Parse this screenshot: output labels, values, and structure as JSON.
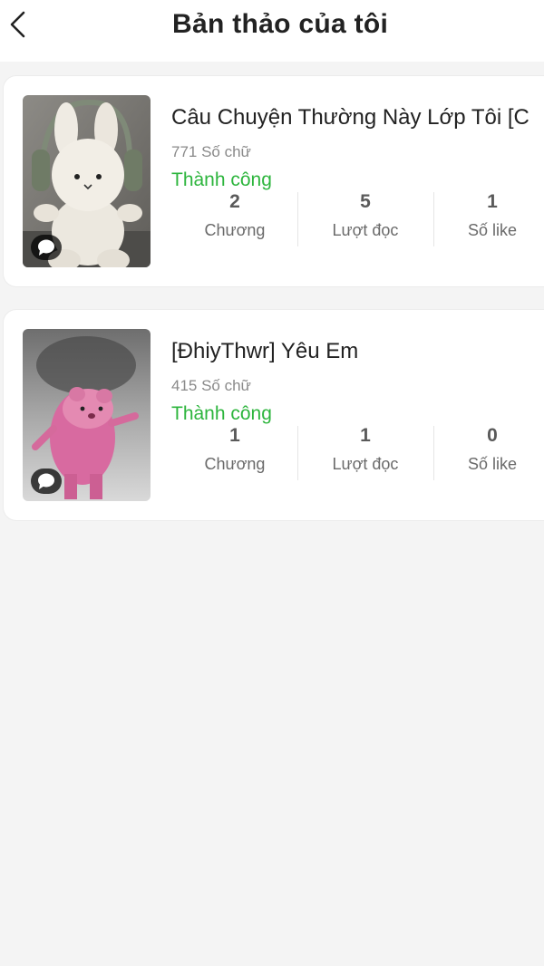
{
  "header": {
    "title": "Bản thảo của tôi",
    "back_icon": "chevron-left-icon"
  },
  "drafts": [
    {
      "title": "Câu Chuyện Thường Này Lớp Tôi [C",
      "word_count": "771 Số chữ",
      "status": "Thành công",
      "cover": "plush-bunny-with-headphones",
      "stats": [
        {
          "value": "2",
          "label": "Chương"
        },
        {
          "value": "5",
          "label": "Lượt đọc"
        },
        {
          "value": "1",
          "label": "Số like"
        }
      ]
    },
    {
      "title": "[ĐhiyThwr] Yêu Em",
      "word_count": "415 Số chữ",
      "status": "Thành công",
      "cover": "pink-dancing-rat",
      "stats": [
        {
          "value": "1",
          "label": "Chương"
        },
        {
          "value": "1",
          "label": "Lượt đọc"
        },
        {
          "value": "0",
          "label": "Số like"
        }
      ]
    }
  ],
  "colors": {
    "status_success": "#2db53d",
    "background": "#f4f4f4",
    "card": "#ffffff"
  }
}
